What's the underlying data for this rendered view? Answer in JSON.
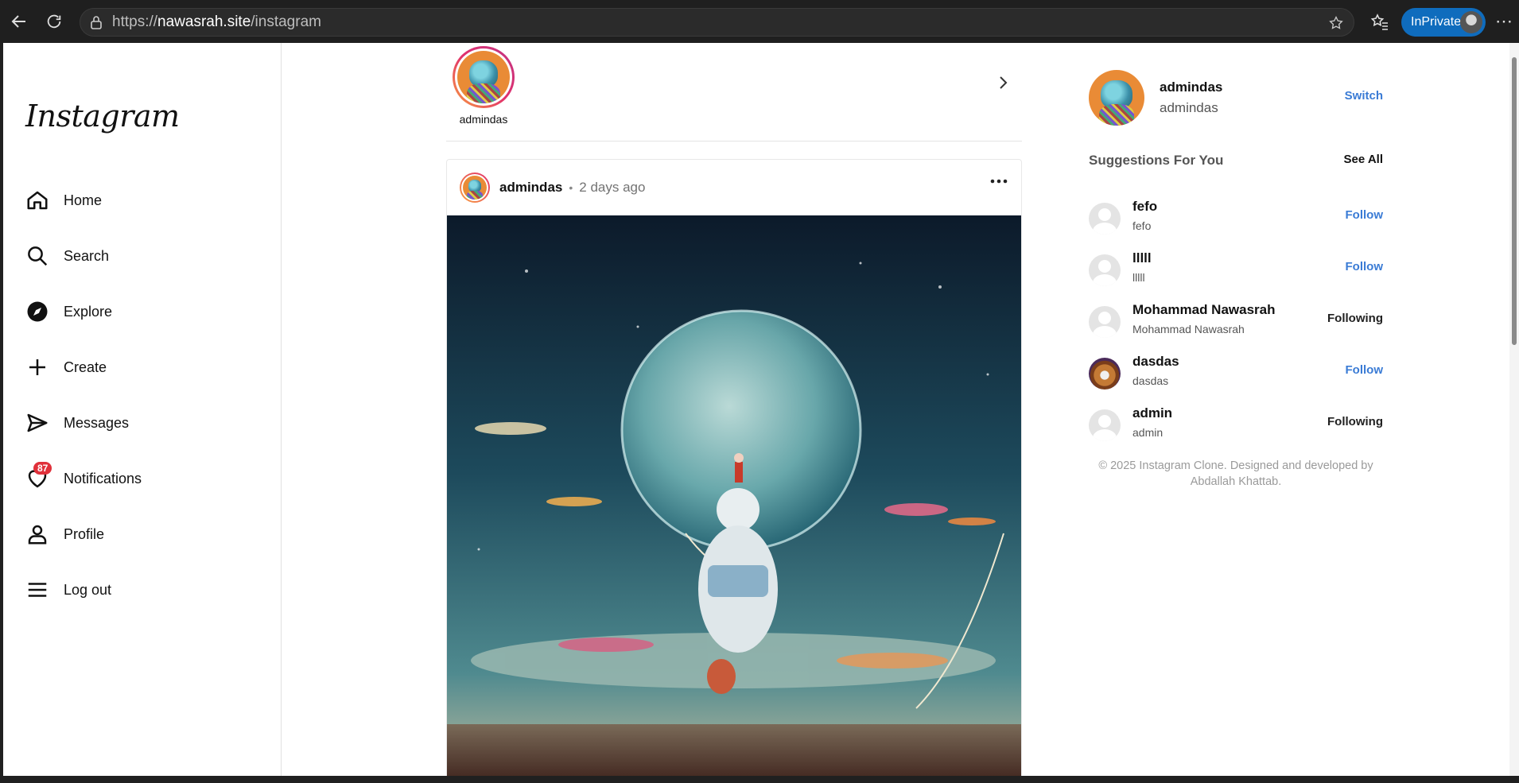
{
  "browser": {
    "url_prefix": "https://",
    "url_domain": "nawasrah.site",
    "url_path": "/instagram",
    "inprivate_label": "InPrivate"
  },
  "sidebar": {
    "logo": "Instagram",
    "items": [
      {
        "label": "Home",
        "icon": "home-icon"
      },
      {
        "label": "Search",
        "icon": "search-icon"
      },
      {
        "label": "Explore",
        "icon": "compass-icon"
      },
      {
        "label": "Create",
        "icon": "plus-icon"
      },
      {
        "label": "Messages",
        "icon": "send-icon"
      },
      {
        "label": "Notifications",
        "icon": "heart-icon",
        "badge": "87"
      },
      {
        "label": "Profile",
        "icon": "user-icon"
      },
      {
        "label": "Log out",
        "icon": "menu-icon"
      }
    ]
  },
  "stories": {
    "items": [
      {
        "name": "admindas"
      }
    ]
  },
  "post": {
    "username": "admindas",
    "separator": "•",
    "time": "2 days ago"
  },
  "right": {
    "me": {
      "username": "admindas",
      "name": "admindas",
      "switch_label": "Switch"
    },
    "suggestions_title": "Suggestions For You",
    "see_all": "See All",
    "suggestions": [
      {
        "username": "fefo",
        "name": "fefo",
        "action": "Follow"
      },
      {
        "username": "lllll",
        "name": "lllll",
        "action": "Follow"
      },
      {
        "username": "Mohammad Nawasrah",
        "name": "Mohammad Nawasrah",
        "action": "Following"
      },
      {
        "username": "dasdas",
        "name": "dasdas",
        "action": "Follow"
      },
      {
        "username": "admin",
        "name": "admin",
        "action": "Following"
      }
    ],
    "copyright_line1": "© 2025 Instagram Clone. Designed and developed by",
    "copyright_line2": "Abdallah Khattab."
  },
  "colors": {
    "link": "#3a7bd5",
    "badge": "#e0303a",
    "browser_accent": "#0f6cbd"
  }
}
